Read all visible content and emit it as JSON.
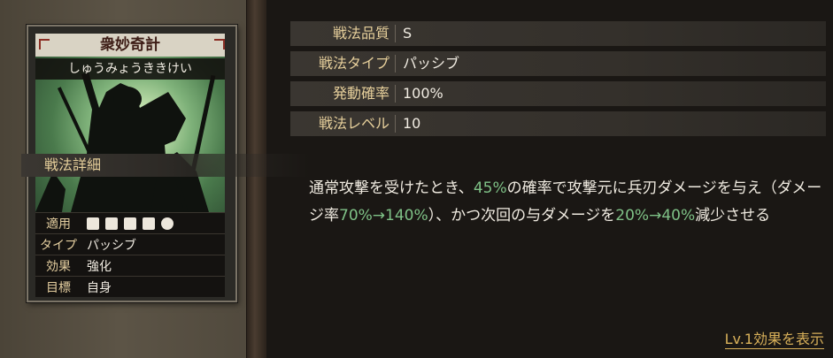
{
  "card": {
    "title": "衆妙奇計",
    "reading": "しゅうみょうききけい",
    "rows": [
      {
        "label": "適用",
        "icons": [
          "horse-icon",
          "shield-icon",
          "bow-icon",
          "spear-icon",
          "wheel-icon"
        ]
      },
      {
        "label": "タイプ",
        "value": "パッシブ"
      },
      {
        "label": "効果",
        "value": "強化"
      },
      {
        "label": "目標",
        "value": "自身"
      }
    ]
  },
  "stats": [
    {
      "key": "戦法品質",
      "value": "S"
    },
    {
      "key": "戦法タイプ",
      "value": "パッシブ"
    },
    {
      "key": "発動確率",
      "value": "100%"
    },
    {
      "key": "戦法レベル",
      "value": "10"
    }
  ],
  "detail": {
    "heading": "戦法詳細",
    "segments": [
      {
        "text": "通常攻撃を受けたとき、"
      },
      {
        "text": "45%",
        "highlight": true
      },
      {
        "text": "の確率で攻撃元に兵刃ダメージを与え（ダメージ率"
      },
      {
        "text": "70%→140%",
        "highlight": true
      },
      {
        "text": "）、かつ次回の与ダメージを"
      },
      {
        "text": "20%→40%",
        "highlight": true
      },
      {
        "text": "減少させる"
      }
    ]
  },
  "footer": {
    "link": "Lv.1効果を表示"
  },
  "colors": {
    "highlight": "#7fc287",
    "label_gold": "#e6cf9b",
    "link": "#d9b15a"
  }
}
